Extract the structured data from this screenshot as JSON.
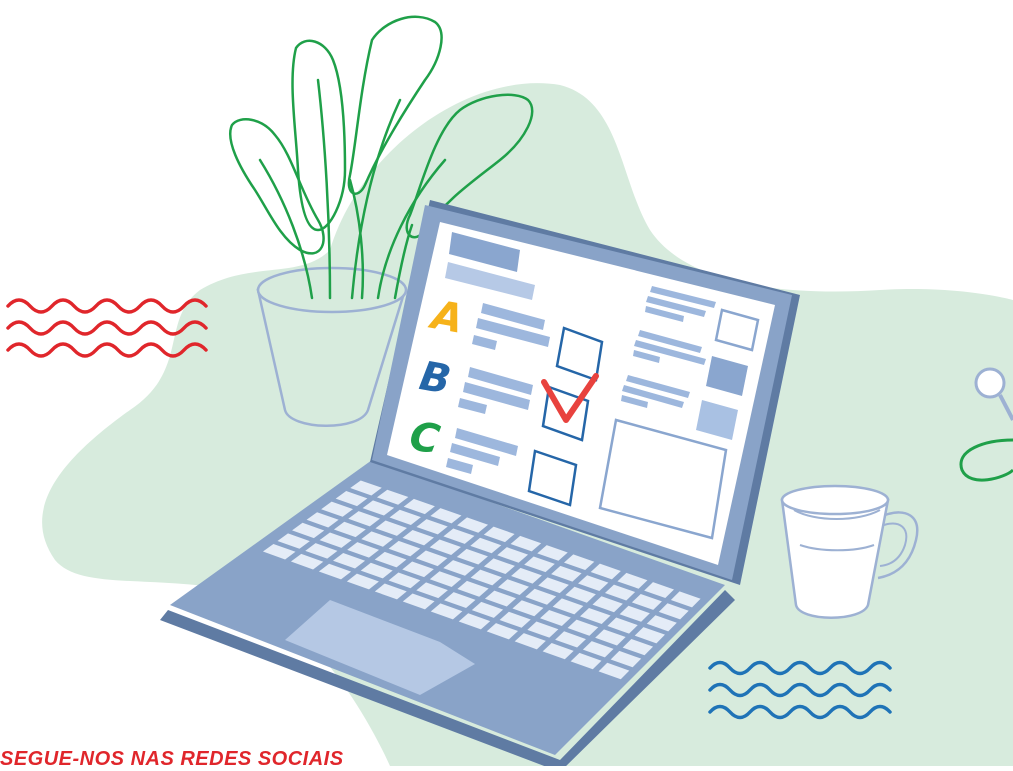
{
  "quiz": {
    "option_a": "A",
    "option_b": "B",
    "option_c": "C"
  },
  "footer": {
    "text": "SEGUE-NOS NAS REDES SOCIAIS"
  },
  "colors": {
    "background_blob": "#d7ebdd",
    "laptop_body": "#89a3c8",
    "laptop_dark": "#5f7ba3",
    "screen": "#ffffff",
    "ui_bars": "#9db7dd",
    "checkbox_stroke": "#2566a8",
    "checkmark": "#e8423e",
    "letter_a": "#f6b21a",
    "letter_b": "#2566a8",
    "letter_c": "#1fa049",
    "plant_leaves": "#1fa049",
    "wave_red": "#e0262b",
    "wave_blue": "#1f73b7",
    "outline": "#9db1d3"
  },
  "icons": [
    "potted-plant-icon",
    "laptop-icon",
    "checkmark-icon",
    "mug-icon",
    "wavy-lines-icon"
  ]
}
